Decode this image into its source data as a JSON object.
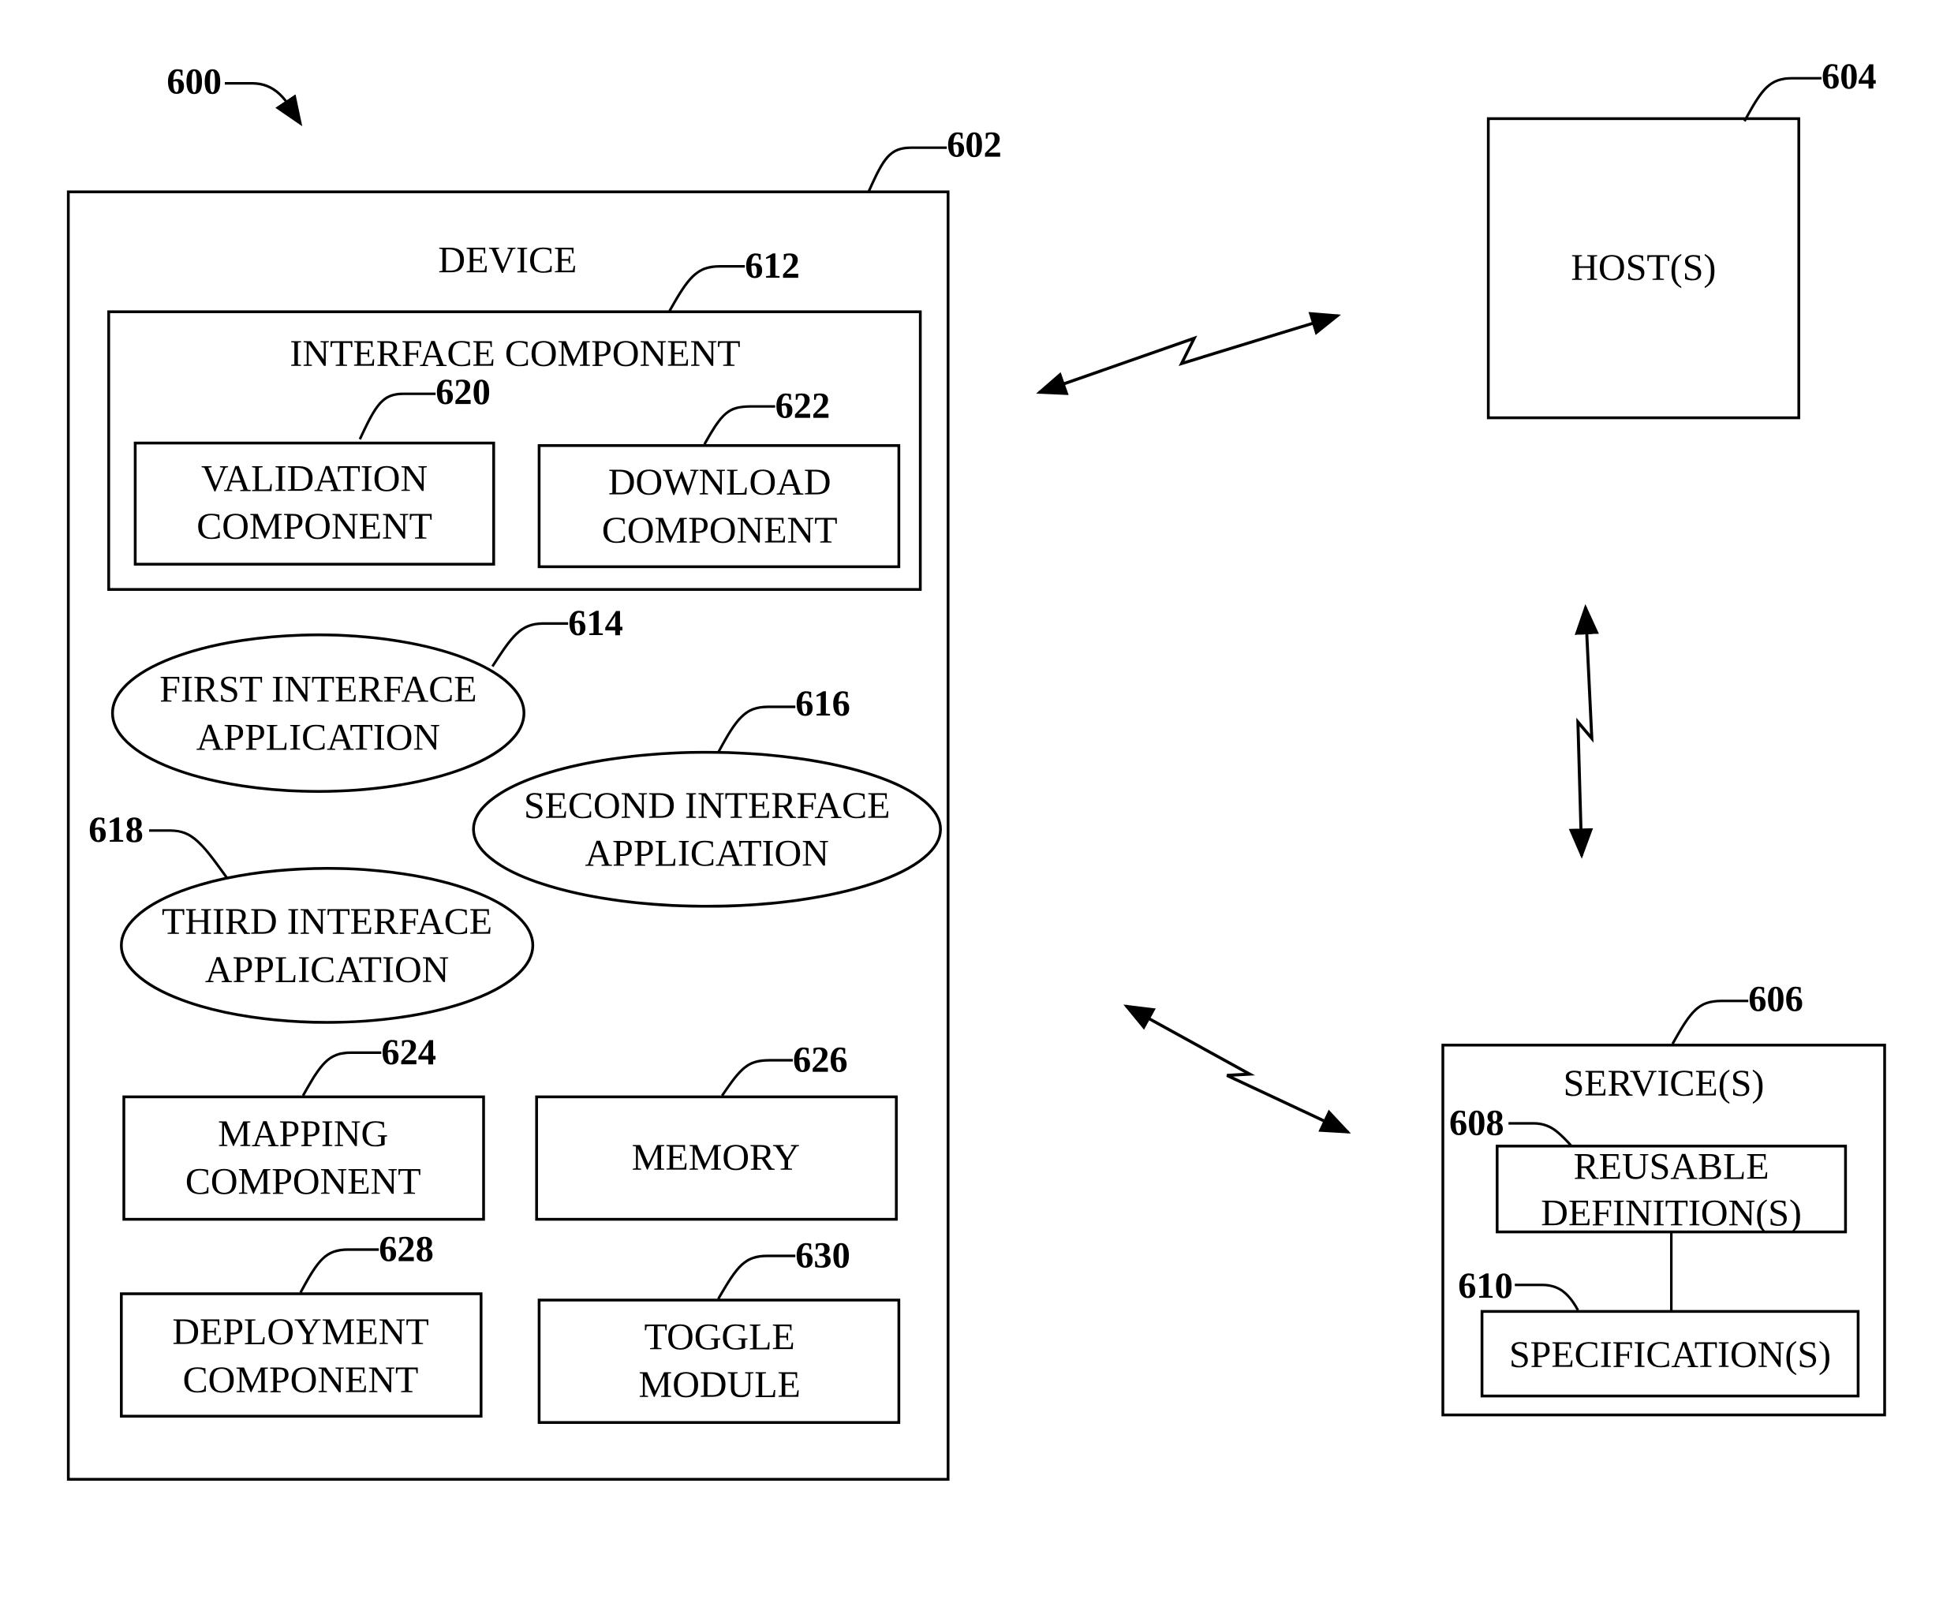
{
  "figure": {
    "figure_ref": "600",
    "device": {
      "ref": "602",
      "title": "DEVICE",
      "interface_component": {
        "ref": "612",
        "title": "INTERFACE COMPONENT",
        "validation": {
          "ref": "620",
          "line1": "VALIDATION",
          "line2": "COMPONENT"
        },
        "download": {
          "ref": "622",
          "line1": "DOWNLOAD",
          "line2": "COMPONENT"
        }
      },
      "first_app": {
        "ref": "614",
        "line1": "FIRST INTERFACE",
        "line2": "APPLICATION"
      },
      "second_app": {
        "ref": "616",
        "line1": "SECOND INTERFACE",
        "line2": "APPLICATION"
      },
      "third_app": {
        "ref": "618",
        "line1": "THIRD INTERFACE",
        "line2": "APPLICATION"
      },
      "mapping": {
        "ref": "624",
        "line1": "MAPPING",
        "line2": "COMPONENT"
      },
      "memory": {
        "ref": "626",
        "line1": "MEMORY"
      },
      "deployment": {
        "ref": "628",
        "line1": "DEPLOYMENT",
        "line2": "COMPONENT"
      },
      "toggle": {
        "ref": "630",
        "line1": "TOGGLE",
        "line2": "MODULE"
      }
    },
    "host": {
      "ref": "604",
      "title": "HOST(S)"
    },
    "service": {
      "ref": "606",
      "title": "SERVICE(S)",
      "reusable": {
        "ref": "608",
        "line1": "REUSABLE",
        "line2": "DEFINITION(S)"
      },
      "specification": {
        "ref": "610",
        "line1": "SPECIFICATION(S)"
      }
    },
    "connections": [
      {
        "from": "DEVICE",
        "to": "HOST(S)",
        "type": "wireless-bidirectional"
      },
      {
        "from": "HOST(S)",
        "to": "SERVICE(S)",
        "type": "wireless-bidirectional"
      },
      {
        "from": "DEVICE",
        "to": "SERVICE(S)",
        "type": "wireless-bidirectional"
      }
    ]
  }
}
